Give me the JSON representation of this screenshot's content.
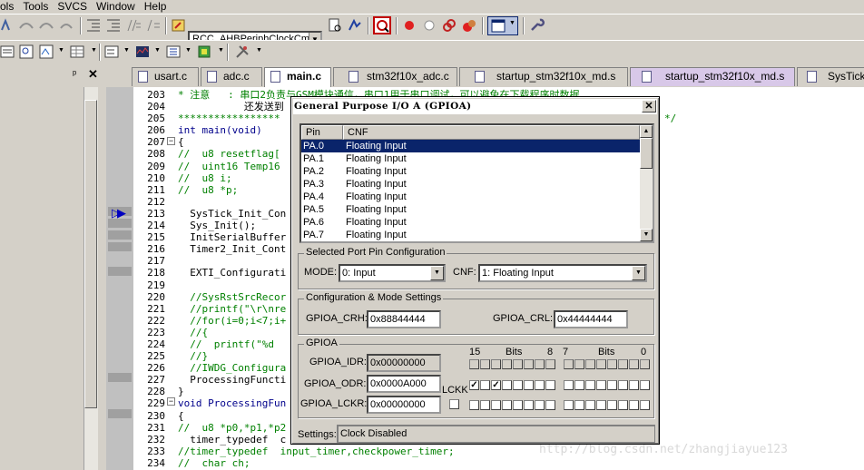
{
  "menubar": {
    "items": [
      "ols",
      "Tools",
      "SVCS",
      "Window",
      "Help"
    ]
  },
  "toolbar": {
    "function_combo": "RCC_AHBPeriphClockCmd("
  },
  "left_panel": {
    "pin_icon": "pin-icon",
    "close_icon": "close-icon"
  },
  "tabs": [
    {
      "label": "usart.c",
      "active": false
    },
    {
      "label": "adc.c",
      "active": false
    },
    {
      "label": "main.c",
      "active": true
    },
    {
      "label": "stm32f10x_adc.c",
      "active": false
    },
    {
      "label": "startup_stm32f10x_md.s",
      "active": false
    },
    {
      "label": "startup_stm32f10x_md.s",
      "active": false
    },
    {
      "label": "SysTick.c",
      "active": false
    }
  ],
  "editor": {
    "line_numbers": [
      "203",
      "204",
      "205",
      "206",
      "207",
      "208",
      "209",
      "210",
      "211",
      "212",
      "213",
      "214",
      "215",
      "216",
      "217",
      "218",
      "219",
      "220",
      "221",
      "222",
      "223",
      "224",
      "225",
      "226",
      "227",
      "228",
      "229",
      "230",
      "231",
      "232",
      "233",
      "234"
    ],
    "lines": [
      "* 注意   : 串口2负责与GSM模块通信，串口1用于串口调试，可以避免在下载程序时数据",
      "           还发送到",
      "*****************",
      "int main(void)",
      "{",
      "//  u8 resetflag[",
      "//  uint16 Temp16",
      "//  u8 i;",
      "//  u8 *p;",
      "",
      "  SysTick_Init_Con",
      "  Sys_Init();",
      "  InitSerialBuffer",
      "  Timer2_Init_Cont",
      "",
      "  EXTI_Configurati",
      "",
      "  //SysRstSrcRecor",
      "  //printf(\"\\r\\nre",
      "  //for(i=0;i<7;i+",
      "  //{",
      "  //  printf(\"%d ",
      "  //}",
      "  //IWDG_Configura",
      "  ProcessingFuncti",
      "}",
      "void ProcessingFun",
      "{",
      "//  u8 *p0,*p1,*p2",
      "  timer_typedef  c",
      "//timer_typedef  input_timer,checkpower_timer;",
      "//  char ch;"
    ],
    "line205_tail": "*/",
    "watermark": "http://blog.csdn.net/zhangjiayue123"
  },
  "dialog": {
    "title": "General Purpose I/O A (GPIOA)",
    "close": "✕",
    "pin_list": {
      "headers": [
        "Pin",
        "CNF"
      ],
      "rows": [
        {
          "pin": "PA.0",
          "cnf": "Floating Input",
          "selected": true
        },
        {
          "pin": "PA.1",
          "cnf": "Floating Input",
          "selected": false
        },
        {
          "pin": "PA.2",
          "cnf": "Floating Input",
          "selected": false
        },
        {
          "pin": "PA.3",
          "cnf": "Floating Input",
          "selected": false
        },
        {
          "pin": "PA.4",
          "cnf": "Floating Input",
          "selected": false
        },
        {
          "pin": "PA.5",
          "cnf": "Floating Input",
          "selected": false
        },
        {
          "pin": "PA.6",
          "cnf": "Floating Input",
          "selected": false
        },
        {
          "pin": "PA.7",
          "cnf": "Floating Input",
          "selected": false
        }
      ]
    },
    "selected_pin_config": {
      "legend": "Selected Port Pin Configuration",
      "mode_label": "MODE:",
      "mode_value": "0: Input",
      "cnf_label": "CNF:",
      "cnf_value": "1: Floating Input"
    },
    "config_mode_settings": {
      "legend": "Configuration & Mode Settings",
      "crh_label": "GPIOA_CRH:",
      "crh_value": "0x88844444",
      "crl_label": "GPIOA_CRL:",
      "crl_value": "0x44444444"
    },
    "gpioa": {
      "legend": "GPIOA",
      "idr_label": "GPIOA_IDR:",
      "idr_value": "0x00000000",
      "odr_label": "GPIOA_ODR:",
      "odr_value": "0x0000A000",
      "lckr_label": "GPIOA_LCKR:",
      "lckr_value": "0x00000000",
      "lckk_label": "LCKK",
      "bit_header_hi": {
        "left": "15",
        "mid": "Bits",
        "right": "8"
      },
      "bit_header_lo": {
        "left": "7",
        "mid": "Bits",
        "right": "0"
      },
      "idr_bits": [
        0,
        0,
        0,
        0,
        0,
        0,
        0,
        0,
        0,
        0,
        0,
        0,
        0,
        0,
        0,
        0
      ],
      "odr_bits": [
        1,
        0,
        1,
        0,
        0,
        0,
        0,
        0,
        0,
        0,
        0,
        0,
        0,
        0,
        0,
        0
      ],
      "lckr_bits": [
        0,
        0,
        0,
        0,
        0,
        0,
        0,
        0,
        0,
        0,
        0,
        0,
        0,
        0,
        0,
        0
      ],
      "lckk_checked": false
    },
    "settings": {
      "label": "Settings:",
      "value": "Clock Disabled"
    }
  },
  "colors": {
    "selection": "#0a246a",
    "comment": "#008000",
    "keyword": "#00008b",
    "tab_purple": "#d8c8e8"
  }
}
